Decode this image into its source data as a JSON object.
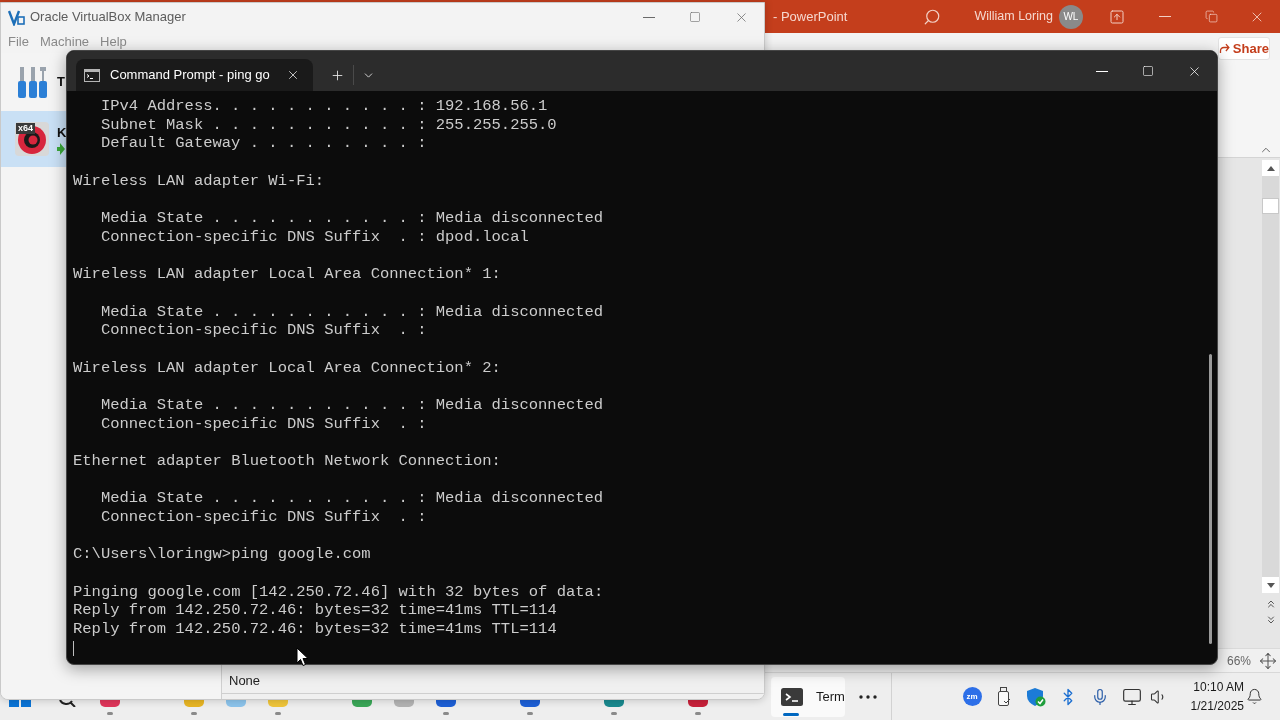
{
  "powerpoint": {
    "title": "- PowerPoint",
    "user_name": "William Loring",
    "avatar_initials": "WL",
    "share_button": "Share",
    "zoom_level": "66%"
  },
  "virtualbox": {
    "title": "Oracle VirtualBox Manager",
    "menu": [
      "File",
      "Machine",
      "Help"
    ],
    "sidebar_items": [
      {
        "kind": "tools",
        "label": "T",
        "selected": false,
        "running": false
      },
      {
        "kind": "machine",
        "label": "K",
        "badge": "x64",
        "selected": true,
        "running": true
      }
    ],
    "details_value": "None"
  },
  "terminal": {
    "tabs": [
      {
        "title": "Command Prompt - ping go",
        "selected": true
      }
    ],
    "blocks": [
      {
        "kind": "entries",
        "lines": [
          "IPv4 Address. . . . . . . . . . . : 192.168.56.1",
          "Subnet Mask . . . . . . . . . . . : 255.255.255.0",
          "Default Gateway . . . . . . . . . :"
        ]
      },
      {
        "kind": "text",
        "lines": [
          "Wireless LAN adapter Wi-Fi:"
        ]
      },
      {
        "kind": "entries",
        "lines": [
          "Media State . . . . . . . . . . . : Media disconnected",
          "Connection-specific DNS Suffix  . : dpod.local"
        ]
      },
      {
        "kind": "text",
        "lines": [
          "Wireless LAN adapter Local Area Connection* 1:"
        ]
      },
      {
        "kind": "entries",
        "lines": [
          "Media State . . . . . . . . . . . : Media disconnected",
          "Connection-specific DNS Suffix  . :"
        ]
      },
      {
        "kind": "text",
        "lines": [
          "Wireless LAN adapter Local Area Connection* 2:"
        ]
      },
      {
        "kind": "entries",
        "lines": [
          "Media State . . . . . . . . . . . : Media disconnected",
          "Connection-specific DNS Suffix  . :"
        ]
      },
      {
        "kind": "text",
        "lines": [
          "Ethernet adapter Bluetooth Network Connection:"
        ]
      },
      {
        "kind": "entries",
        "lines": [
          "Media State . . . . . . . . . . . : Media disconnected",
          "Connection-specific DNS Suffix  . :"
        ]
      },
      {
        "kind": "text",
        "lines": [
          "C:\\Users\\loringw>ping google.com"
        ]
      },
      {
        "kind": "text",
        "lines": [
          "Pinging google.com [142.250.72.46] with 32 bytes of data:",
          "Reply from 142.250.72.46: bytes=32 time=41ms TTL=114",
          "Reply from 142.250.72.46: bytes=32 time=41ms TTL=114"
        ]
      }
    ]
  },
  "taskbar": {
    "pinned": [
      {
        "kind": "start",
        "running": false
      },
      {
        "kind": "search",
        "running": false
      },
      {
        "kind": "app",
        "color": "#e0355a",
        "running": true
      },
      {
        "kind": "app",
        "color": "#e8b523",
        "running": true
      },
      {
        "kind": "app",
        "color": "#8cc4ec",
        "running": false
      },
      {
        "kind": "app",
        "color": "#f0c53a",
        "running": true
      },
      {
        "kind": "app",
        "color": "#3aa757",
        "running": false
      },
      {
        "kind": "app",
        "color": "#b3b3b3",
        "running": false
      },
      {
        "kind": "app",
        "color": "#1d5fd6",
        "running": true
      },
      {
        "kind": "app",
        "color": "#1d5fd6",
        "running": true
      },
      {
        "kind": "app",
        "color": "#19898e",
        "running": true
      },
      {
        "kind": "app",
        "color": "#c8203a",
        "running": true
      }
    ],
    "windows": [
      {
        "label": "Term",
        "selected": true
      }
    ],
    "tray": [
      {
        "kind": "zoom",
        "label": "zm"
      },
      {
        "kind": "usb"
      },
      {
        "kind": "security"
      },
      {
        "kind": "bluetooth"
      },
      {
        "kind": "mic"
      },
      {
        "kind": "network"
      },
      {
        "kind": "volume"
      }
    ],
    "clock": {
      "time": "10:10 AM",
      "date": "1/21/2025"
    }
  }
}
